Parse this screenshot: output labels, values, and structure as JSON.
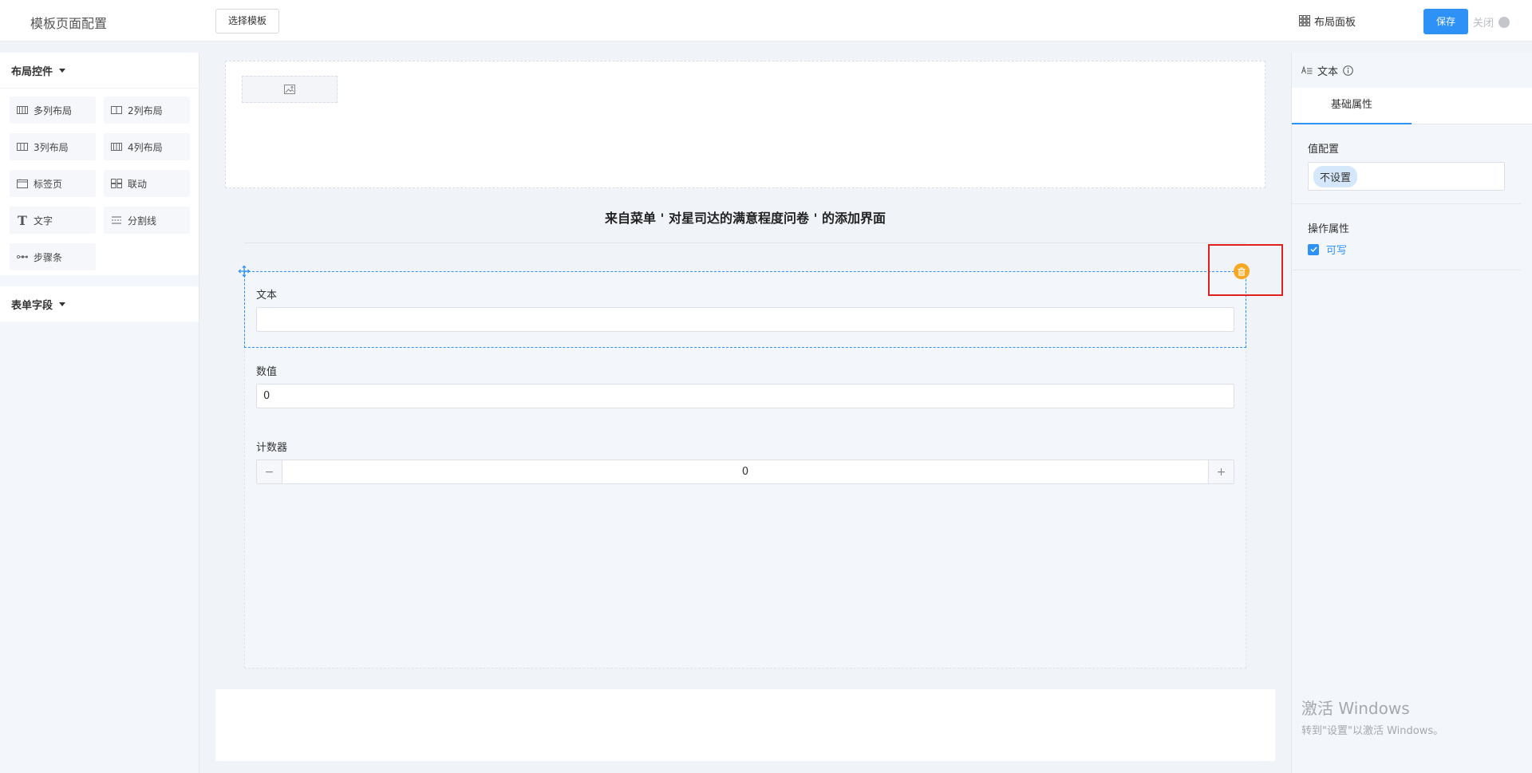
{
  "header": {
    "title": "模板页面配置",
    "select_template": "选择模板",
    "layout_panel": "布局面板",
    "save": "保存",
    "close": "关闭"
  },
  "left_panel": {
    "layout_section": "布局控件",
    "layout_widgets": [
      {
        "label": "多列布局",
        "icon": "columns-icon"
      },
      {
        "label": "2列布局",
        "icon": "two-columns-icon"
      },
      {
        "label": "3列布局",
        "icon": "three-columns-icon"
      },
      {
        "label": "4列布局",
        "icon": "four-columns-icon"
      },
      {
        "label": "标签页",
        "icon": "tabs-icon"
      },
      {
        "label": "联动",
        "icon": "linkage-icon"
      },
      {
        "label": "文字",
        "icon": "text-icon"
      },
      {
        "label": "分割线",
        "icon": "divider-icon"
      },
      {
        "label": "步骤条",
        "icon": "steps-icon"
      }
    ],
    "form_section": "表单字段"
  },
  "canvas": {
    "form_title": "来自菜单 ' 对星司达的满意程度问卷 ' 的添加界面",
    "fields": [
      {
        "label": "文本",
        "value": ""
      },
      {
        "label": "数值",
        "value": "0"
      },
      {
        "label": "计数器",
        "value": "0"
      }
    ]
  },
  "right_panel": {
    "header": "文本",
    "tab": "基础属性",
    "value_config_label": "值配置",
    "value_config_tag": "不设置",
    "operation_label": "操作属性",
    "writable_label": "可写"
  },
  "watermark": {
    "line1": "激活 Windows",
    "line2": "转到\"设置\"以激活 Windows。"
  },
  "colors": {
    "primary": "#2e91f5",
    "delete": "#f7a823",
    "highlight": "#e0201f"
  }
}
